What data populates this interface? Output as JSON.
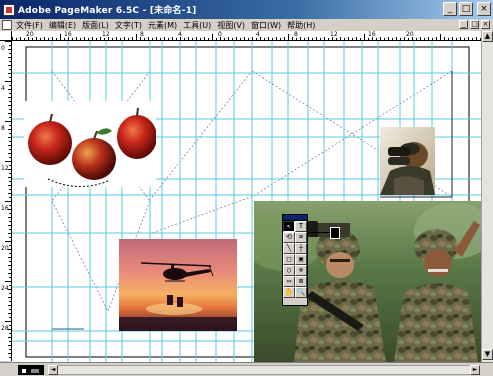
{
  "window": {
    "title": "Adobe PageMaker 6.5C - [未命名-1]",
    "buttons": {
      "minimize": "_",
      "maximize": "□",
      "close": "×"
    }
  },
  "menu": {
    "items": [
      "文件(F)",
      "编辑(E)",
      "版面(L)",
      "文字(T)",
      "元素(M)",
      "工具(U)",
      "视图(V)",
      "窗口(W)",
      "帮助(H)"
    ],
    "doc_buttons": {
      "minimize": "_",
      "maximize": "□",
      "close": "×"
    }
  },
  "ruler": {
    "h_labels": [
      "",
      "20",
      "16",
      "12",
      "8",
      "4",
      "0",
      "4",
      "8",
      "12",
      "16",
      "20",
      ""
    ],
    "v_labels": [
      "0",
      "4",
      "8",
      "12",
      "16",
      "20",
      "24",
      "28"
    ]
  },
  "scrollbar": {
    "up": "▲",
    "down": "▼",
    "left": "◄",
    "right": "►"
  },
  "toolbox": {
    "tools": [
      "↖",
      "T",
      "⟲",
      "⌧",
      "╲",
      "┼",
      "□",
      "▣",
      "○",
      "⊗",
      "▭",
      "⊠",
      "✋",
      "🔍"
    ],
    "active_index": 0
  },
  "images": {
    "apples": "apples-photo",
    "helicopter": "helicopter-sunset-photo",
    "binoculars": "soldier-binoculars-photo",
    "soldiers": "soldiers-photo"
  },
  "colors": {
    "guide": "#5ec8e0",
    "titlebar_start": "#0a246a",
    "titlebar_end": "#a6caf0",
    "chrome": "#d4d0c8"
  }
}
